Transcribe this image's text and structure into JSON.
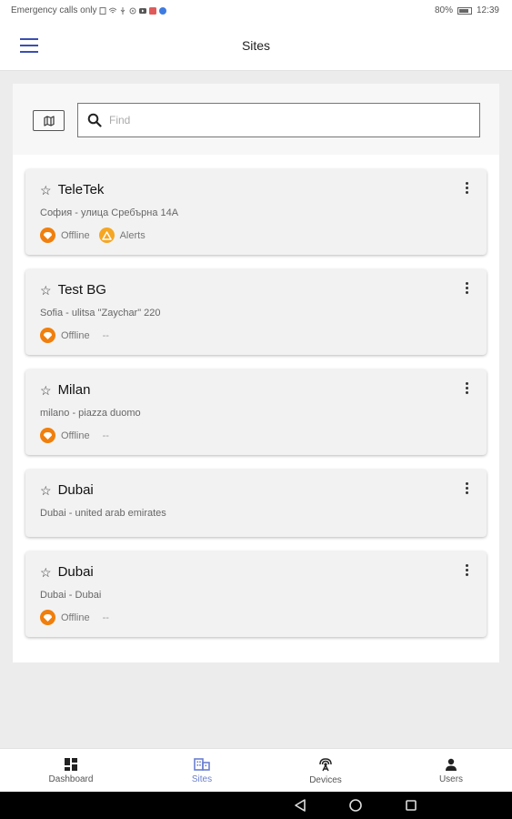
{
  "status_bar": {
    "left_text": "Emergency calls only",
    "battery": "80%",
    "time": "12:39"
  },
  "app_bar": {
    "title": "Sites",
    "menu_icon": "hamburger-menu-icon"
  },
  "search": {
    "placeholder": "Find",
    "value": "",
    "map_icon": "map-icon",
    "search_icon": "search-icon"
  },
  "sites": [
    {
      "name": "TeleTek",
      "address": "София - улица Сребърна 14А",
      "statuses": [
        {
          "label": "Offline",
          "icon": "offline-icon"
        },
        {
          "label": "Alerts",
          "icon": "alert-icon"
        }
      ]
    },
    {
      "name": "Test BG",
      "address": "Sofia - ulitsa \"Zaychar\" 220",
      "statuses": [
        {
          "label": "Offline",
          "icon": "offline-icon"
        }
      ],
      "extra": "--"
    },
    {
      "name": "Milan",
      "address": "milano - piazza duomo",
      "statuses": [
        {
          "label": "Offline",
          "icon": "offline-icon"
        }
      ],
      "extra": "--"
    },
    {
      "name": "Dubai",
      "address": "Dubai - united arab emirates",
      "statuses": []
    },
    {
      "name": "Dubai",
      "address": "Dubai - Dubai",
      "statuses": [
        {
          "label": "Offline",
          "icon": "offline-icon"
        }
      ],
      "extra": "--"
    }
  ],
  "bottom_nav": {
    "items": [
      {
        "label": "Dashboard",
        "icon": "dashboard-icon"
      },
      {
        "label": "Sites",
        "icon": "sites-icon"
      },
      {
        "label": "Devices",
        "icon": "devices-icon"
      },
      {
        "label": "Users",
        "icon": "users-icon"
      }
    ],
    "active": "Sites"
  },
  "colors": {
    "accent": "#3a4fb2",
    "active_nav": "#6b7fd0",
    "offline": "#f07f0d",
    "alert": "#f5a623"
  }
}
